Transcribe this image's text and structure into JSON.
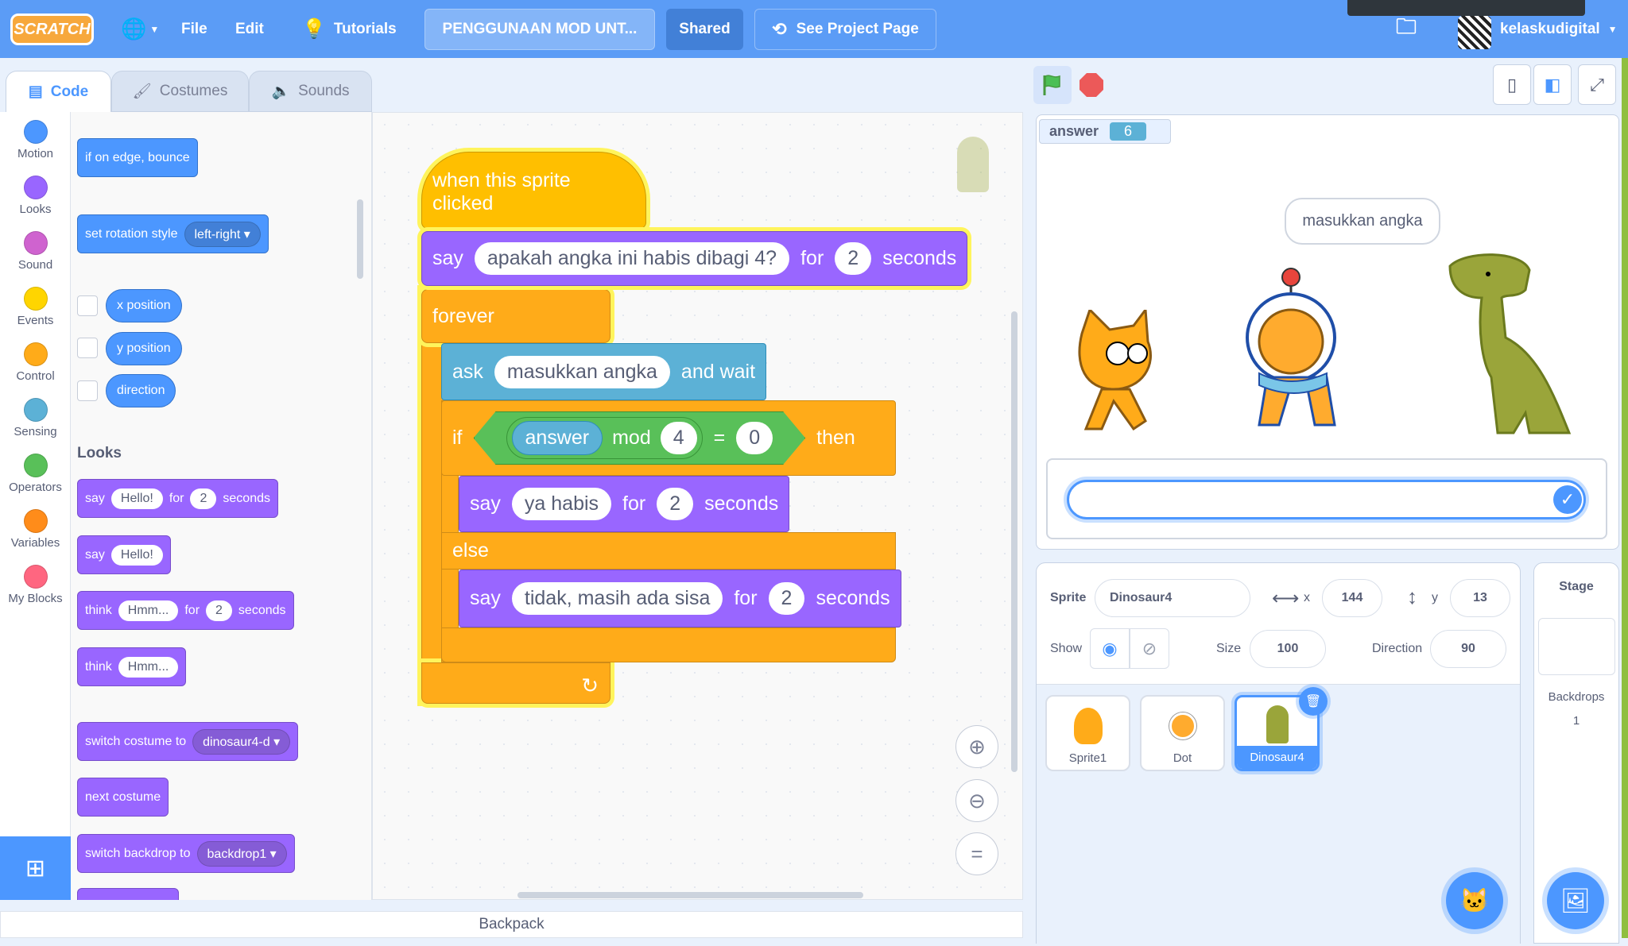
{
  "topbar": {
    "logo": "SCRATCH",
    "file": "File",
    "edit": "Edit",
    "tutorials": "Tutorials",
    "project_title": "PENGGUNAAN MOD UNT...",
    "shared": "Shared",
    "see_project": "See Project Page",
    "username": "kelaskudigital"
  },
  "tabs": [
    {
      "label": "Code"
    },
    {
      "label": "Costumes"
    },
    {
      "label": "Sounds"
    }
  ],
  "categories": [
    {
      "label": "Motion",
      "color": "#4c97ff"
    },
    {
      "label": "Looks",
      "color": "#9966ff"
    },
    {
      "label": "Sound",
      "color": "#cf63cf"
    },
    {
      "label": "Events",
      "color": "#ffd500"
    },
    {
      "label": "Control",
      "color": "#ffab19"
    },
    {
      "label": "Sensing",
      "color": "#5cb1d6"
    },
    {
      "label": "Operators",
      "color": "#59c059"
    },
    {
      "label": "Variables",
      "color": "#ff8c1a"
    },
    {
      "label": "My Blocks",
      "color": "#ff6680"
    }
  ],
  "palette": {
    "edge_bounce": "if on edge, bounce",
    "rotation": "set rotation style",
    "rotation_val": "left-right",
    "xpos": "x position",
    "ypos": "y position",
    "direction": "direction",
    "looks_heading": "Looks",
    "say": "say",
    "think": "think",
    "hello": "Hello!",
    "hmm": "Hmm...",
    "for": "for",
    "two": "2",
    "seconds": "seconds",
    "switch_costume": "switch costume to",
    "costume_val": "dinosaur4-d",
    "next_costume": "next costume",
    "switch_backdrop": "switch backdrop to",
    "backdrop_val": "backdrop1"
  },
  "script": {
    "hat": "when this sprite clicked",
    "say": "say",
    "say1_text": "apakah angka ini habis dibagi 4?",
    "for": "for",
    "two": "2",
    "seconds": "seconds",
    "forever": "forever",
    "ask": "ask",
    "ask_text": "masukkan angka",
    "and_wait": "and wait",
    "if": "if",
    "answer": "answer",
    "mod": "mod",
    "four": "4",
    "eq": "=",
    "zero": "0",
    "then": "then",
    "say2_text": "ya habis",
    "else": "else",
    "say3_text": "tidak, masih ada sisa"
  },
  "backpack": "Backpack",
  "stage": {
    "monitor_label": "answer",
    "monitor_value": "6",
    "bubble": "masukkan angka",
    "input_value": ""
  },
  "sprite_info": {
    "sprite_label": "Sprite",
    "sprite_name": "Dinosaur4",
    "x_label": "x",
    "x": "144",
    "y_label": "y",
    "y": "13",
    "show_label": "Show",
    "size_label": "Size",
    "size": "100",
    "direction_label": "Direction",
    "direction": "90"
  },
  "sprites": [
    {
      "name": "Sprite1"
    },
    {
      "name": "Dot"
    },
    {
      "name": "Dinosaur4",
      "selected": true
    }
  ],
  "stage_panel": {
    "title": "Stage",
    "backdrops_label": "Backdrops",
    "backdrops_count": "1"
  }
}
